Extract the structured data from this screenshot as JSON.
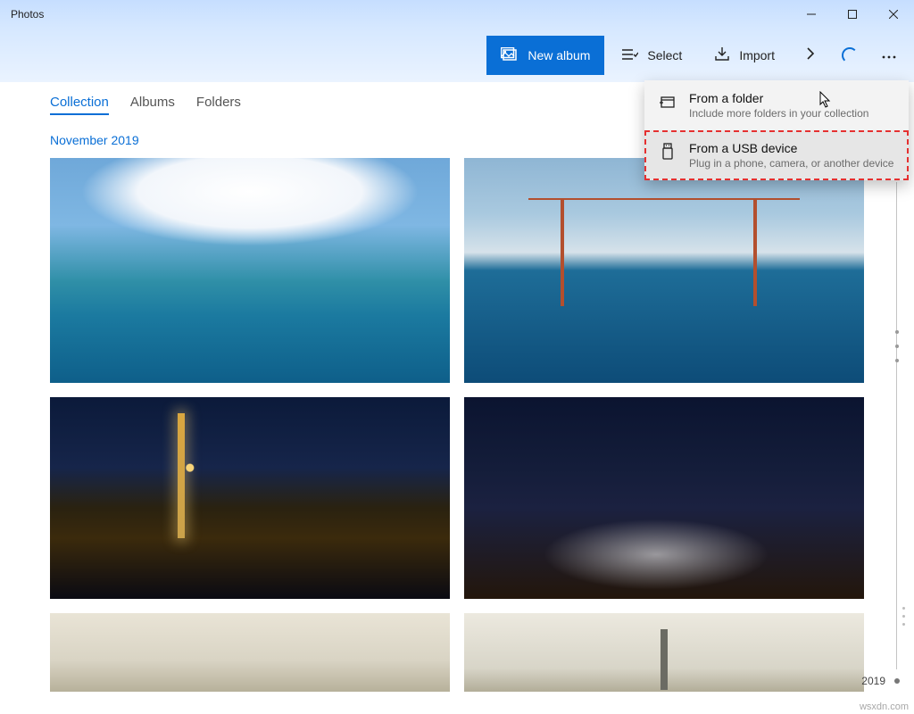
{
  "window": {
    "title": "Photos"
  },
  "toolbar": {
    "new_album": "New album",
    "select": "Select",
    "import": "Import"
  },
  "tabs": [
    {
      "label": "Collection",
      "active": true
    },
    {
      "label": "Albums",
      "active": false
    },
    {
      "label": "Folders",
      "active": false
    }
  ],
  "collection": {
    "group_date": "November 2019"
  },
  "dropdown": {
    "items": [
      {
        "title": "From a folder",
        "subtitle": "Include more folders in your collection"
      },
      {
        "title": "From a USB device",
        "subtitle": "Plug in a phone, camera, or another device"
      }
    ]
  },
  "timeline": {
    "year": "2019"
  },
  "watermark": "wsxdn.com"
}
